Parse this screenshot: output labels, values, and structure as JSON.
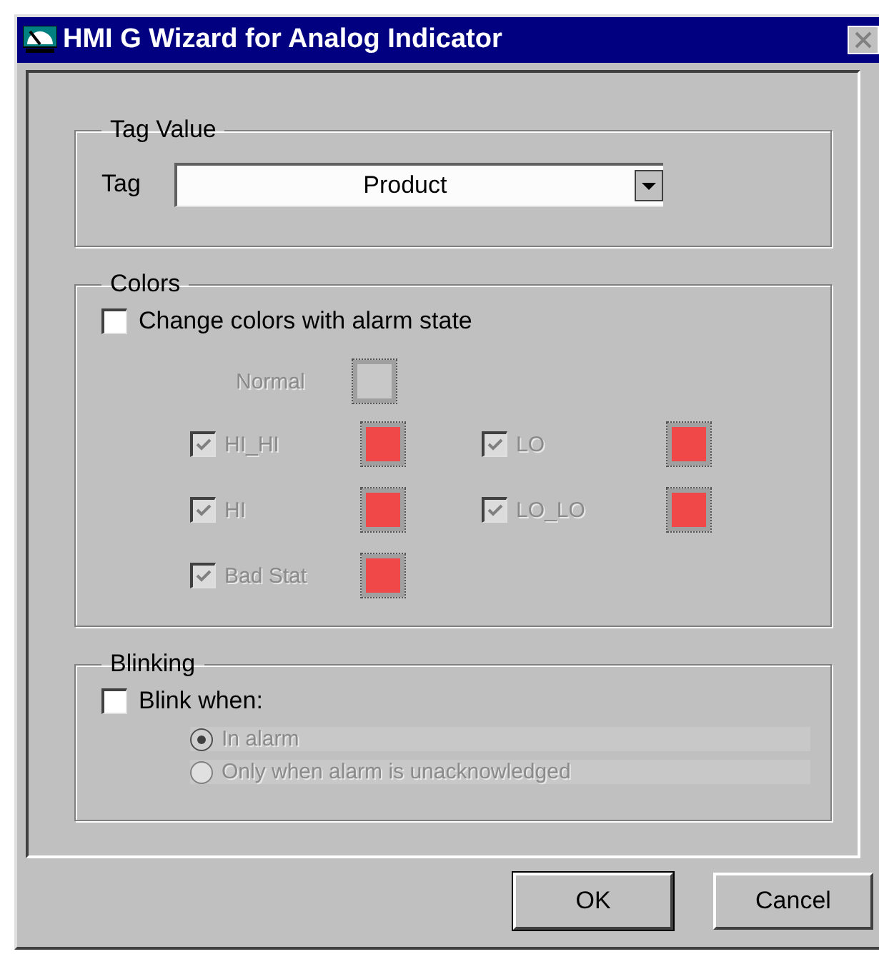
{
  "window": {
    "title": "HMI G Wizard for Analog Indicator"
  },
  "tag_value": {
    "title": "Tag Value",
    "label": "Tag",
    "value": "Product"
  },
  "colors": {
    "title": "Colors",
    "change_with_alarm": {
      "label": "Change colors with alarm state",
      "checked": false
    },
    "normal": {
      "label": "Normal",
      "color": "#c8c8c8",
      "disabled": true
    },
    "states": [
      {
        "label": "HI_HI",
        "checked": true,
        "color": "#f04848",
        "disabled": true
      },
      {
        "label": "LO",
        "checked": true,
        "color": "#f04848",
        "disabled": true
      },
      {
        "label": "HI",
        "checked": true,
        "color": "#f04848",
        "disabled": true
      },
      {
        "label": "LO_LO",
        "checked": true,
        "color": "#f04848",
        "disabled": true
      },
      {
        "label": "Bad Stat",
        "checked": true,
        "color": "#f04848",
        "disabled": true
      }
    ]
  },
  "blinking": {
    "title": "Blinking",
    "blink_when": {
      "label": "Blink when:",
      "checked": false
    },
    "options": [
      {
        "label": "In alarm",
        "selected": true,
        "disabled": true
      },
      {
        "label": "Only when alarm is unacknowledged",
        "selected": false,
        "disabled": true
      }
    ]
  },
  "buttons": [
    {
      "label": "OK",
      "default": true
    },
    {
      "label": "Cancel",
      "default": false
    }
  ]
}
